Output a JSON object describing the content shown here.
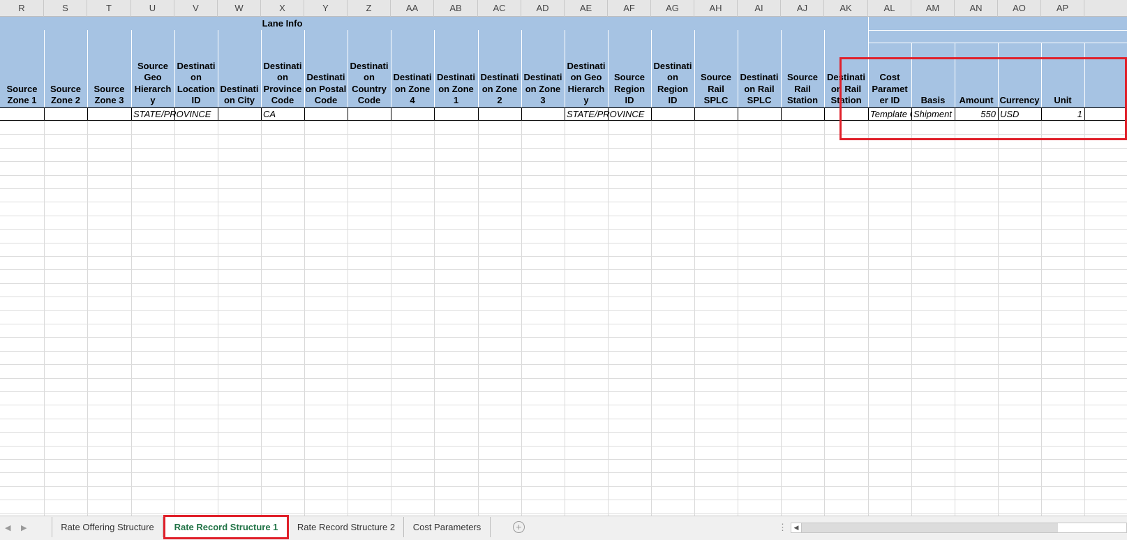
{
  "column_headers": [
    "R",
    "S",
    "T",
    "U",
    "V",
    "W",
    "X",
    "Y",
    "Z",
    "AA",
    "AB",
    "AC",
    "AD",
    "AE",
    "AF",
    "AG",
    "AH",
    "AI",
    "AJ",
    "AK",
    "AL",
    "AM",
    "AN",
    "AO",
    "AP"
  ],
  "group_header": "Lane Info",
  "field_headers": [
    "Source Zone 1",
    "Source Zone 2",
    "Source Zone 3",
    "Source Geo Hierarchy",
    "Destination Location ID",
    "Destination City",
    "Destination Province Code",
    "Destination Postal Code",
    "Destination Country Code",
    "Destination Zone 4",
    "Destination Zone 1",
    "Destination Zone 2",
    "Destination Zone 3",
    "Destination Geo Hierarchy",
    "Source Region ID",
    "Destination Region ID",
    "Source Rail SPLC",
    "Destination Rail SPLC",
    "Source Rail Station",
    "Destination Rail Station",
    "Cost Parameter ID",
    "Basis",
    "Amount",
    "Currency",
    "Unit"
  ],
  "data_row": [
    "",
    "",
    "",
    "STATE/PROVINCE",
    "",
    "",
    "CA",
    "",
    "",
    "",
    "",
    "",
    "",
    "STATE/PROVINCE",
    "",
    "",
    "",
    "",
    "",
    "",
    "Template Cost",
    "Shipment",
    "550",
    "USD",
    "1"
  ],
  "sheet_tabs": {
    "tab1": "Rate Offering Structure",
    "tab2": "Rate Record Structure 1",
    "tab3": "Rate Record Structure 2",
    "tab4": "Cost Parameters"
  },
  "active_tab": "Rate Record Structure 1",
  "colors": {
    "header_blue": "#a6c3e3",
    "highlight_red": "#e0202a",
    "active_tab_text": "#217346"
  },
  "icons": {
    "prev_sheet": "chevron-left-icon",
    "next_sheet": "chevron-right-icon",
    "add_sheet": "plus-circle-icon",
    "options": "vertical-dots-icon",
    "scroll_left": "triangle-left-icon"
  }
}
